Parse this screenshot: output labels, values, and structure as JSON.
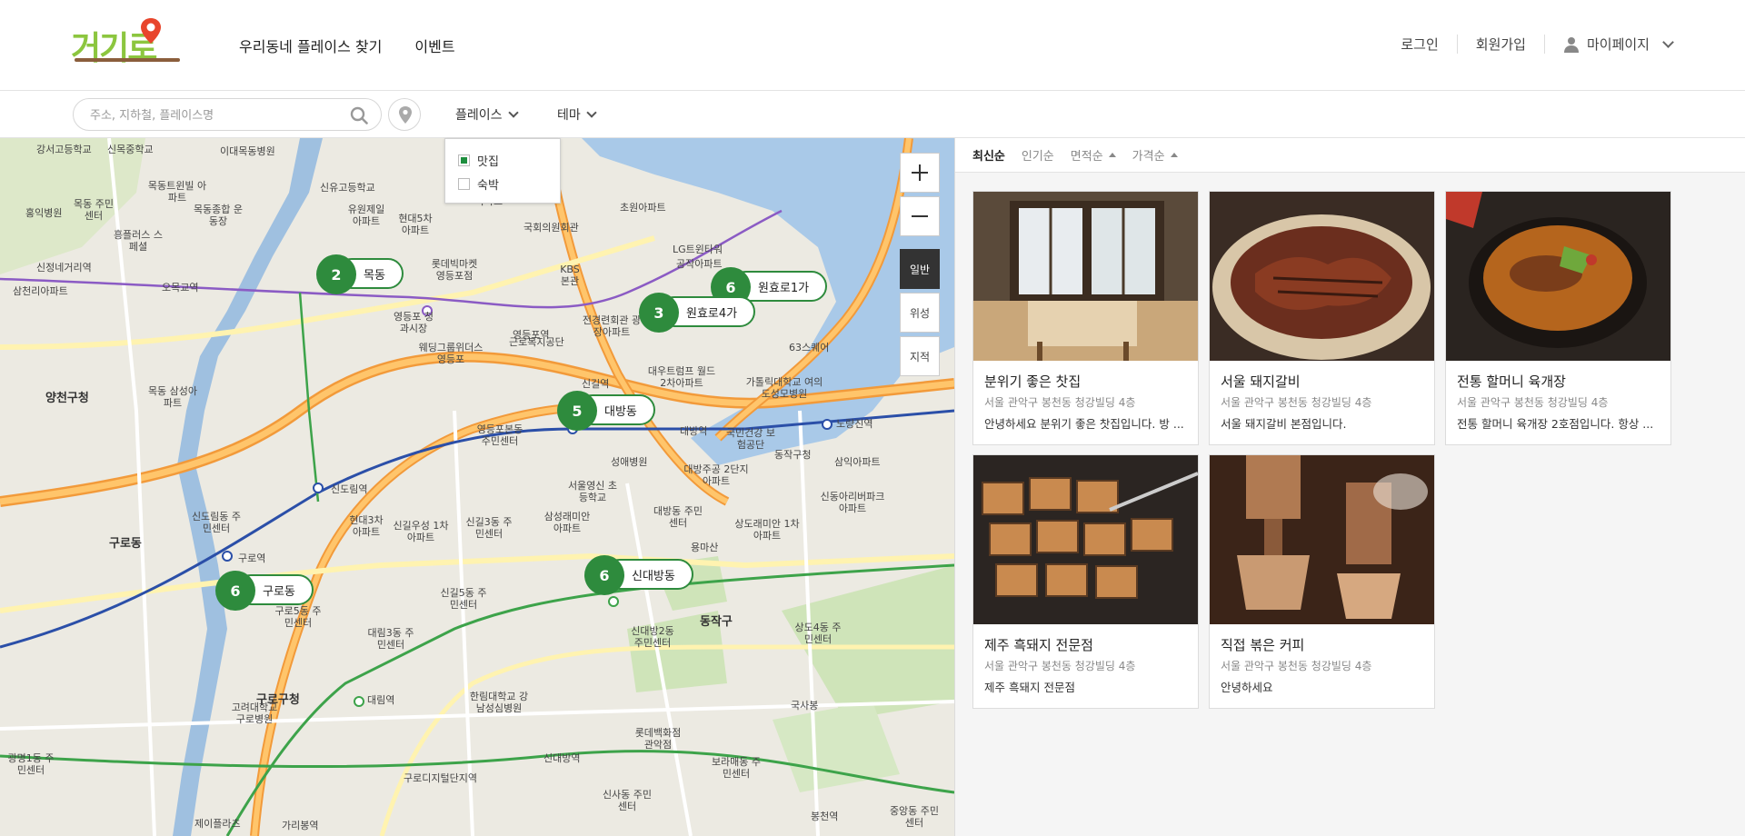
{
  "header": {
    "logo_text": "거기로",
    "nav": [
      "우리동네 플레이스 찾기",
      "이벤트"
    ],
    "login": "로그인",
    "signup": "회원가입",
    "mypage": "마이페이지"
  },
  "search": {
    "placeholder": "주소, 지하철, 플레이스명",
    "place_dropdown": "플레이스",
    "theme_dropdown": "테마"
  },
  "filter": {
    "options": [
      {
        "label": "맛집",
        "checked": true
      },
      {
        "label": "숙박",
        "checked": false
      }
    ]
  },
  "map": {
    "type_buttons": [
      "일반",
      "위성",
      "지적"
    ],
    "active_type": "일반",
    "clusters": [
      {
        "count": "2",
        "label": "목동"
      },
      {
        "count": "6",
        "label": "원효로1가"
      },
      {
        "count": "3",
        "label": "원효로4가"
      },
      {
        "count": "5",
        "label": "대방동"
      },
      {
        "count": "6",
        "label": "신대방동"
      },
      {
        "count": "6",
        "label": "구로동"
      }
    ],
    "labels": [
      "강서고등학교",
      "신목중학교",
      "이대목동병원",
      "목동트윈빌 아파트",
      "목동종합 운동장",
      "목동 주민센터",
      "홍익병원",
      "흥플러스 스페셜",
      "신유고등학교",
      "유원제일 아파트",
      "현대5차 아파트",
      "강변래미안 아파트",
      "국회의원회관",
      "초원아파트",
      "LG트윈타워",
      "공작아파트",
      "KBS 본관",
      "롯데빅마켓 영등포점",
      "삼천리아파트",
      "오목교역",
      "신정네거리역",
      "영등포역",
      "영등포 청과시장",
      "웨딩그룹위더스 영등포",
      "전경련회관 광장아파트",
      "근로복지공단",
      "대우트럼프 월드2차아파트",
      "가톨릭대학교 여의도성모병원",
      "63스퀘어",
      "노량진역",
      "양천구청",
      "목동 삼성아파트",
      "신길역",
      "대방역",
      "국민건강 보험공단",
      "동작구청",
      "삼익아파트",
      "영등포본동 주민센터",
      "성애병원",
      "대방주공 2단지아파트",
      "서울영신 초등학교",
      "신동아리버파크 아파트",
      "신도림역",
      "신도림동 주민센터",
      "현대3차 아파트",
      "신길우성 1차아파트",
      "신길3동 주민센터",
      "삼성래미안 아파트",
      "대방동 주민센터",
      "용마산",
      "상도래미안 1차아파트",
      "구로역",
      "구로동",
      "구로5동 주민센터",
      "대림3동 주민센터",
      "신길5동 주민센터",
      "신대방2동 주민센터",
      "동작구",
      "상도4동 주민센터",
      "구로구청",
      "대림역",
      "한림대학교 강남성심병원",
      "국사봉",
      "고려대학교 구로병원",
      "롯데백화점 관악점",
      "보라매동 주민센터",
      "신대방역",
      "구로디지털단지역",
      "신사동 주민센터",
      "봉천역",
      "광명1동 주민센터",
      "제이플라츠",
      "가리봉역",
      "중앙동 주민센터"
    ]
  },
  "sort": {
    "options": [
      "최신순",
      "인기순",
      "면적순",
      "가격순"
    ],
    "active": "최신순"
  },
  "places": [
    {
      "title": "분위기 좋은 찻집",
      "address": "서울 관악구 봉천동 청강빌딩 4층",
      "desc": "안녕하세요 분위기 좋은 찻집입니다. 방 ...",
      "image": "tea-room-window"
    },
    {
      "title": "서울 돼지갈비",
      "address": "서울 관악구 봉천동 청강빌딩 4층",
      "desc": "서울 돼지갈비 본점입니다.",
      "image": "grilled-ribs"
    },
    {
      "title": "전통 할머니 육개장",
      "address": "서울 관악구 봉천동 청강빌딩 4층",
      "desc": "전통 할머니 육개장 2호점입니다. 항상 ...",
      "image": "spicy-beef-soup"
    },
    {
      "title": "제주 흑돼지 전문점",
      "address": "서울 관악구 봉천동 청강빌딩 4층",
      "desc": "제주 흑돼지 전문점",
      "image": "grilled-pork-belly"
    },
    {
      "title": "직접 볶은 커피",
      "address": "서울 관악구 봉천동 청강빌딩 4층",
      "desc": "안녕하세요",
      "image": "espresso-machine"
    }
  ],
  "colors": {
    "brand_green": "#2e8b3d",
    "logo_green": "#8cc63f",
    "logo_pin": "#e8452c"
  }
}
